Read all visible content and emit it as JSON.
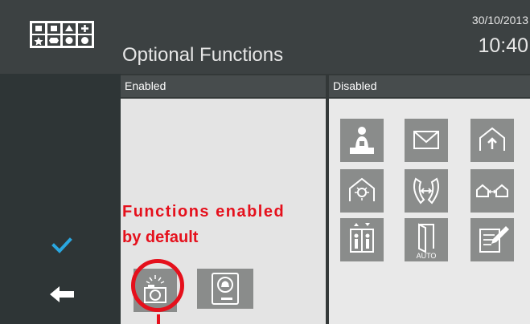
{
  "header": {
    "title": "Optional Functions",
    "date": "30/10/2013",
    "time": "10:40",
    "logo_icon": "intercom-buttons-logo-icon"
  },
  "sidebar": {
    "confirm_icon": "checkmark-icon",
    "back_icon": "back-arrow-icon",
    "confirm_color": "#2aa7e0"
  },
  "enabled_panel": {
    "label": "Enabled",
    "functions": [
      {
        "name": "camera-function",
        "icon": "camera-icon"
      },
      {
        "name": "doorbell-function",
        "icon": "doorbell-icon"
      }
    ]
  },
  "disabled_panel": {
    "label": "Disabled",
    "functions": [
      {
        "name": "concierge-function",
        "icon": "concierge-icon"
      },
      {
        "name": "message-function",
        "icon": "envelope-icon"
      },
      {
        "name": "house-light-function",
        "icon": "house-light-icon"
      },
      {
        "name": "alarm-house-function",
        "icon": "house-alarm-icon"
      },
      {
        "name": "call-transfer-function",
        "icon": "call-transfer-icon"
      },
      {
        "name": "house-link-function",
        "icon": "house-link-icon"
      },
      {
        "name": "lift-function",
        "icon": "elevator-icon"
      },
      {
        "name": "auto-door-function",
        "icon": "auto-door-icon",
        "text": "AUTO"
      },
      {
        "name": "notes-function",
        "icon": "notepad-icon"
      }
    ]
  },
  "annotation": {
    "line1": "Functions enabled",
    "line2": "by default",
    "color": "#e5101c"
  }
}
